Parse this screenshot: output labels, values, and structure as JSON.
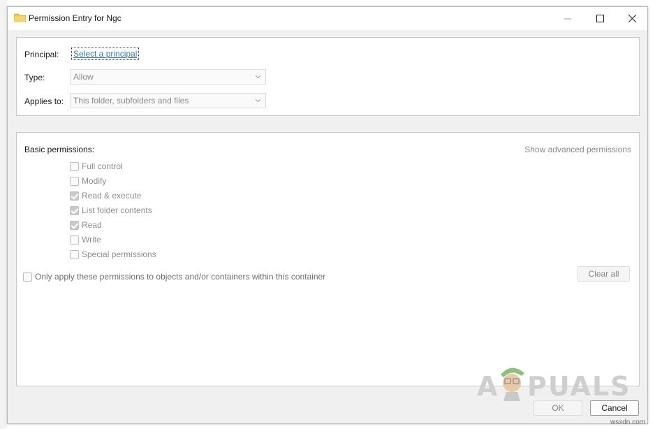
{
  "window": {
    "title": "Permission Entry for Ngc"
  },
  "top_panel": {
    "principal_label": "Principal:",
    "principal_link": "Select a principal",
    "type_label": "Type:",
    "type_value": "Allow",
    "applies_label": "Applies to:",
    "applies_value": "This folder, subfolders and files"
  },
  "permissions": {
    "heading": "Basic permissions:",
    "advanced_link": "Show advanced permissions",
    "items": [
      {
        "label": "Full control",
        "checked": false
      },
      {
        "label": "Modify",
        "checked": false
      },
      {
        "label": "Read & execute",
        "checked": true
      },
      {
        "label": "List folder contents",
        "checked": true
      },
      {
        "label": "Read",
        "checked": true
      },
      {
        "label": "Write",
        "checked": false
      },
      {
        "label": "Special permissions",
        "checked": false
      }
    ],
    "only_apply_label": "Only apply these permissions to objects and/or containers within this container",
    "clear_all": "Clear all"
  },
  "footer": {
    "ok": "OK",
    "cancel": "Cancel"
  },
  "watermark": {
    "left": "A",
    "right": "PUALS"
  },
  "source_tag": "wsxdn.com"
}
